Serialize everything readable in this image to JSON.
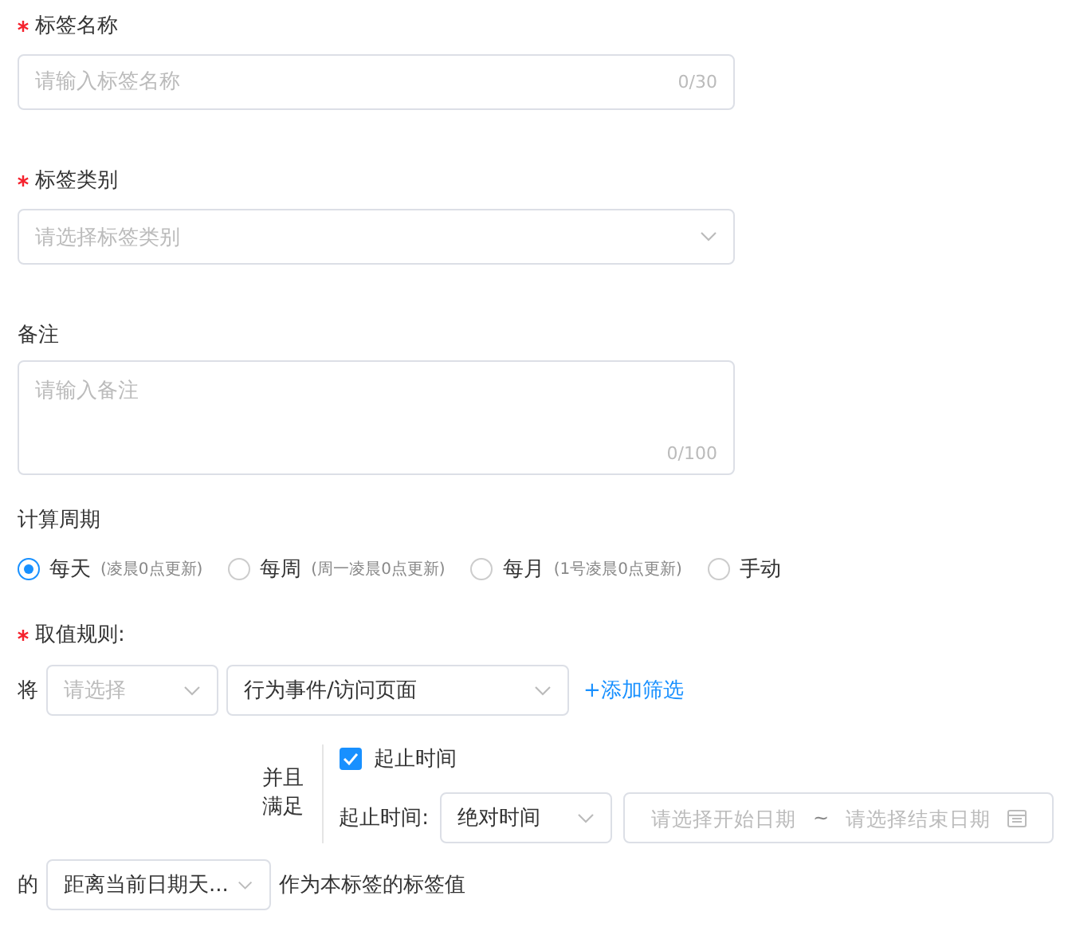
{
  "fields": [
    {
      "kind": "input",
      "label": "标签名称",
      "required": true,
      "placeholder": "请输入标签名称",
      "counter": "0/30"
    },
    {
      "kind": "select",
      "label": "标签类别",
      "required": true,
      "placeholder": "请选择标签类别"
    },
    {
      "kind": "textarea",
      "label": "备注",
      "required": false,
      "placeholder": "请输入备注",
      "counter": "0/100"
    }
  ],
  "period": {
    "label": "计算周期",
    "options": [
      {
        "label": "每天",
        "note": "(凌晨0点更新)",
        "selected": true
      },
      {
        "label": "每周",
        "note": "(周一凌晨0点更新)",
        "selected": false
      },
      {
        "label": "每月",
        "note": "(1号凌晨0点更新)",
        "selected": false
      },
      {
        "label": "手动",
        "selected": false
      }
    ]
  },
  "rule": {
    "label": "取值规则:",
    "required": true,
    "prefix": "将",
    "event_type": {
      "placeholder": "请选择"
    },
    "event": {
      "value": "行为事件/访问页面"
    },
    "add_filter": "+添加筛选",
    "condition": {
      "connector": "并且满足",
      "checkbox": {
        "label": "起止时间",
        "checked": true
      },
      "time_label": "起止时间:",
      "time_mode": {
        "value": "绝对时间"
      },
      "date_range": {
        "start_placeholder": "请选择开始日期",
        "separator": "~",
        "end_placeholder": "请选择结束日期"
      }
    },
    "of": "的",
    "value_select": {
      "value": "距离当前日期天..."
    },
    "suffix": "作为本标签的标签值"
  }
}
